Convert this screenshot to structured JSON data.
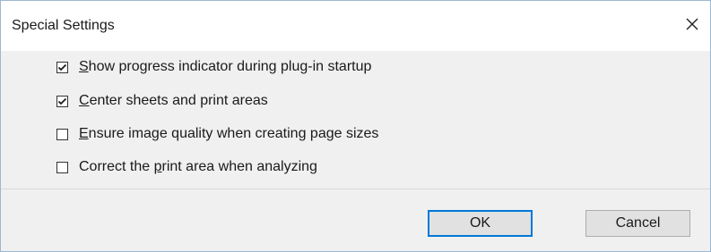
{
  "window": {
    "title": "Special Settings"
  },
  "options": [
    {
      "accel": "S",
      "rest": "how progress indicator during plug-in startup",
      "checked": true
    },
    {
      "accel": "C",
      "rest": "enter sheets and print areas",
      "checked": true
    },
    {
      "accel": "E",
      "rest": "nsure image quality when creating page sizes",
      "checked": false
    },
    {
      "pre": "Correct the ",
      "accel": "p",
      "rest": "rint area when analyzing",
      "checked": false
    }
  ],
  "buttons": {
    "ok_label": "OK",
    "cancel_label": "Cancel"
  },
  "icons": {
    "close": "close-icon",
    "check": "checkmark-icon"
  }
}
